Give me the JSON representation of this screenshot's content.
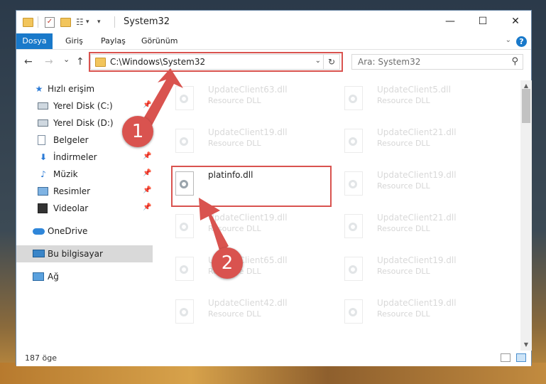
{
  "window": {
    "title": "System32"
  },
  "window_controls": {
    "minimize": "—",
    "maximize": "☐",
    "close": "✕"
  },
  "ribbon": {
    "tabs": [
      "Dosya",
      "Giriş",
      "Paylaş",
      "Görünüm"
    ],
    "help": "?"
  },
  "nav": {
    "back": "←",
    "forward": "→",
    "recent": "⌄",
    "up": "↑",
    "address": "C:\\Windows\\System32",
    "search_placeholder": "Ara: System32"
  },
  "sidebar": {
    "items": [
      {
        "label": "Hızlı erişim",
        "icon": "star-icon"
      },
      {
        "label": "Yerel Disk (C:)",
        "icon": "drive-icon",
        "pinned": true
      },
      {
        "label": "Yerel Disk (D:)",
        "icon": "drive-icon",
        "pinned": true
      },
      {
        "label": "Belgeler",
        "icon": "document-icon",
        "pinned": true
      },
      {
        "label": "İndirmeler",
        "icon": "download-icon",
        "pinned": true
      },
      {
        "label": "Müzik",
        "icon": "music-icon",
        "pinned": true
      },
      {
        "label": "Resimler",
        "icon": "picture-icon",
        "pinned": true
      },
      {
        "label": "Videolar",
        "icon": "video-icon",
        "pinned": true
      },
      {
        "label": "OneDrive",
        "icon": "cloud-icon"
      },
      {
        "label": "Bu bilgisayar",
        "icon": "computer-icon",
        "selected": true
      },
      {
        "label": "Ağ",
        "icon": "network-icon"
      }
    ]
  },
  "files": [
    {
      "name": "UpdateClient63.dll",
      "desc": "Resource DLL",
      "faded": true
    },
    {
      "name": "UpdateClient5.dll",
      "desc": "Resource DLL",
      "faded": true
    },
    {
      "name": "UpdateClient19.dll",
      "desc": "Resource DLL",
      "faded": true
    },
    {
      "name": "UpdateClient21.dll",
      "desc": "Resource DLL",
      "faded": true
    },
    {
      "name": "platinfo.dll",
      "desc": "",
      "faded": false,
      "highlighted": true
    },
    {
      "name": "UpdateClient19.dll",
      "desc": "Resource DLL",
      "faded": true
    },
    {
      "name": "UpdateClient19.dll",
      "desc": "Resource DLL",
      "faded": true
    },
    {
      "name": "UpdateClient21.dll",
      "desc": "Resource DLL",
      "faded": true
    },
    {
      "name": "UpdateClient65.dll",
      "desc": "Resource DLL",
      "faded": true
    },
    {
      "name": "UpdateClient19.dll",
      "desc": "Resource DLL",
      "faded": true
    },
    {
      "name": "UpdateClient42.dll",
      "desc": "Resource DLL",
      "faded": true
    },
    {
      "name": "UpdateClient19.dll",
      "desc": "Resource DLL",
      "faded": true
    }
  ],
  "status": {
    "item_count": "187 öge"
  },
  "annotations": {
    "step1": "1",
    "step2": "2",
    "color": "#d9534f"
  }
}
